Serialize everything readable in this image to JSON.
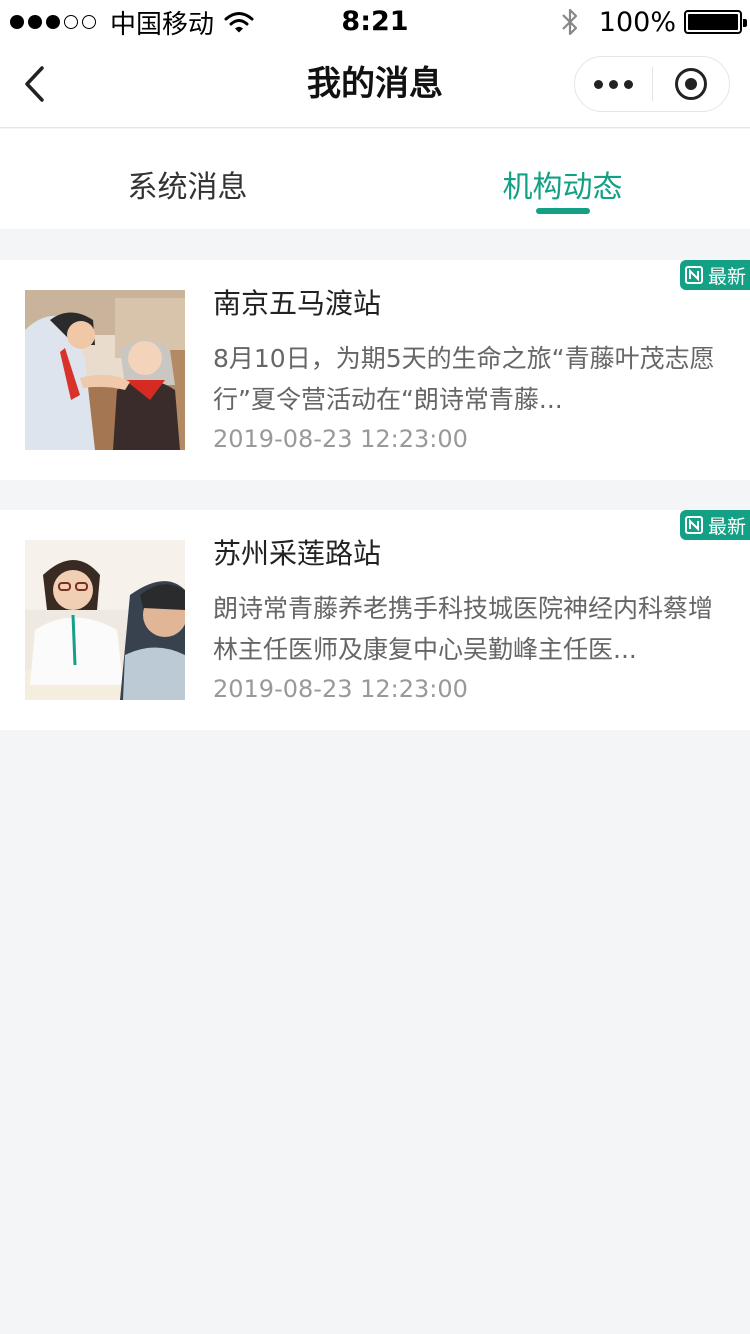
{
  "status_bar": {
    "carrier": "中国移动",
    "time": "8:21",
    "battery": "100%"
  },
  "nav": {
    "title": "我的消息"
  },
  "tabs": [
    {
      "label": "系统消息",
      "active": false
    },
    {
      "label": "机构动态",
      "active": true
    }
  ],
  "messages": [
    {
      "title": "南京五马渡站",
      "description": "8月10日，为期5天的生命之旅“青藤叶茂志愿行”夏令营活动在“朗诗常青藤...",
      "time": "2019-08-23 12:23:00",
      "badge": "最新"
    },
    {
      "title": "苏州采莲路站",
      "description": "朗诗常青藤养老携手科技城医院神经内科蔡增林主任医师及康复中心吴勤峰主任医...",
      "time": "2019-08-23 12:23:00",
      "badge": "最新"
    }
  ],
  "colors": {
    "accent": "#14a085",
    "background": "#f4f5f7"
  }
}
